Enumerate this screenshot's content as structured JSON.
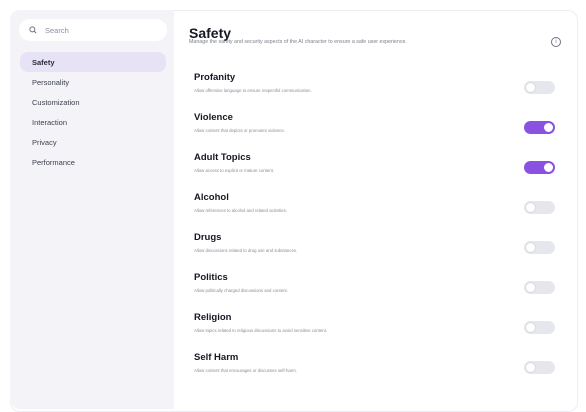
{
  "search": {
    "placeholder": "Search"
  },
  "sidebar": {
    "items": [
      {
        "label": "Safety",
        "active": true
      },
      {
        "label": "Personality",
        "active": false
      },
      {
        "label": "Customization",
        "active": false
      },
      {
        "label": "Interaction",
        "active": false
      },
      {
        "label": "Privacy",
        "active": false
      },
      {
        "label": "Performance",
        "active": false
      }
    ]
  },
  "main": {
    "title": "Safety",
    "subtitle": "Manage the safety and security aspects of the AI character to ensure a safe user experience.",
    "info_icon": "info-icon",
    "settings": [
      {
        "title": "Profanity",
        "description": "Allow offensive language to ensure respectful communication.",
        "enabled": false
      },
      {
        "title": "Violence",
        "description": "Allow content that depicts or promotes violence.",
        "enabled": true
      },
      {
        "title": "Adult Topics",
        "description": "Allow access to explicit or mature content.",
        "enabled": true
      },
      {
        "title": "Alcohol",
        "description": "Allow references to alcohol and related activities.",
        "enabled": false
      },
      {
        "title": "Drugs",
        "description": "Allow discussions related to drug use and substances.",
        "enabled": false
      },
      {
        "title": "Politics",
        "description": "Allow politically charged discussions and content.",
        "enabled": false
      },
      {
        "title": "Religion",
        "description": "Allow topics related to religious discussions to avoid sensitive content.",
        "enabled": false
      },
      {
        "title": "Self Harm",
        "description": "Allow content that encourages or discusses self-harm.",
        "enabled": false
      }
    ]
  },
  "colors": {
    "accent": "#8a52e0",
    "sidebar_bg": "#f4f4f8",
    "active_item_bg": "#e7e2f5"
  }
}
